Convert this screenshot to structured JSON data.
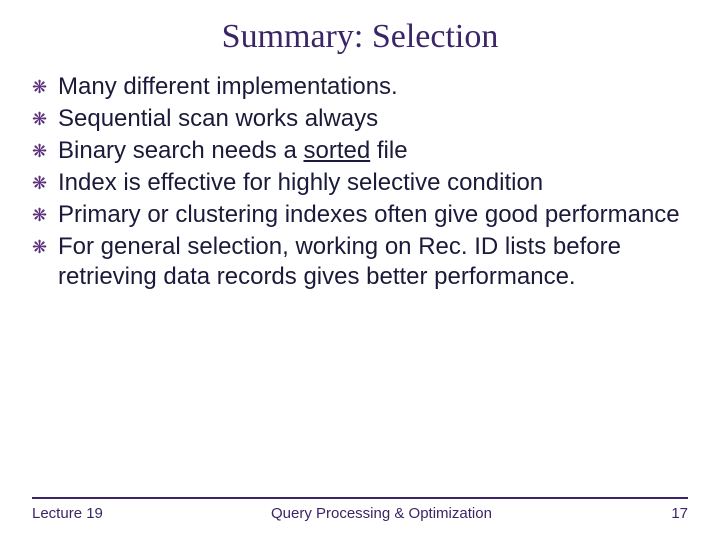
{
  "title": "Summary: Selection",
  "bullets": [
    {
      "pre": "Many different implementations.",
      "uword": "",
      "post": ""
    },
    {
      "pre": "Sequential scan works always",
      "uword": "",
      "post": ""
    },
    {
      "pre": "Binary search needs a ",
      "uword": "sorted",
      "post": " file"
    },
    {
      "pre": "Index is effective for highly selective condition",
      "uword": "",
      "post": ""
    },
    {
      "pre": "Primary or clustering indexes often give good performance",
      "uword": "",
      "post": ""
    },
    {
      "pre": "For general selection, working on Rec. ID lists before retrieving data records gives better performance.",
      "uword": "",
      "post": ""
    }
  ],
  "footer": {
    "left": "Lecture 19",
    "center": "Query Processing & Optimization",
    "right": "17"
  },
  "bullet_glyph": "❋"
}
